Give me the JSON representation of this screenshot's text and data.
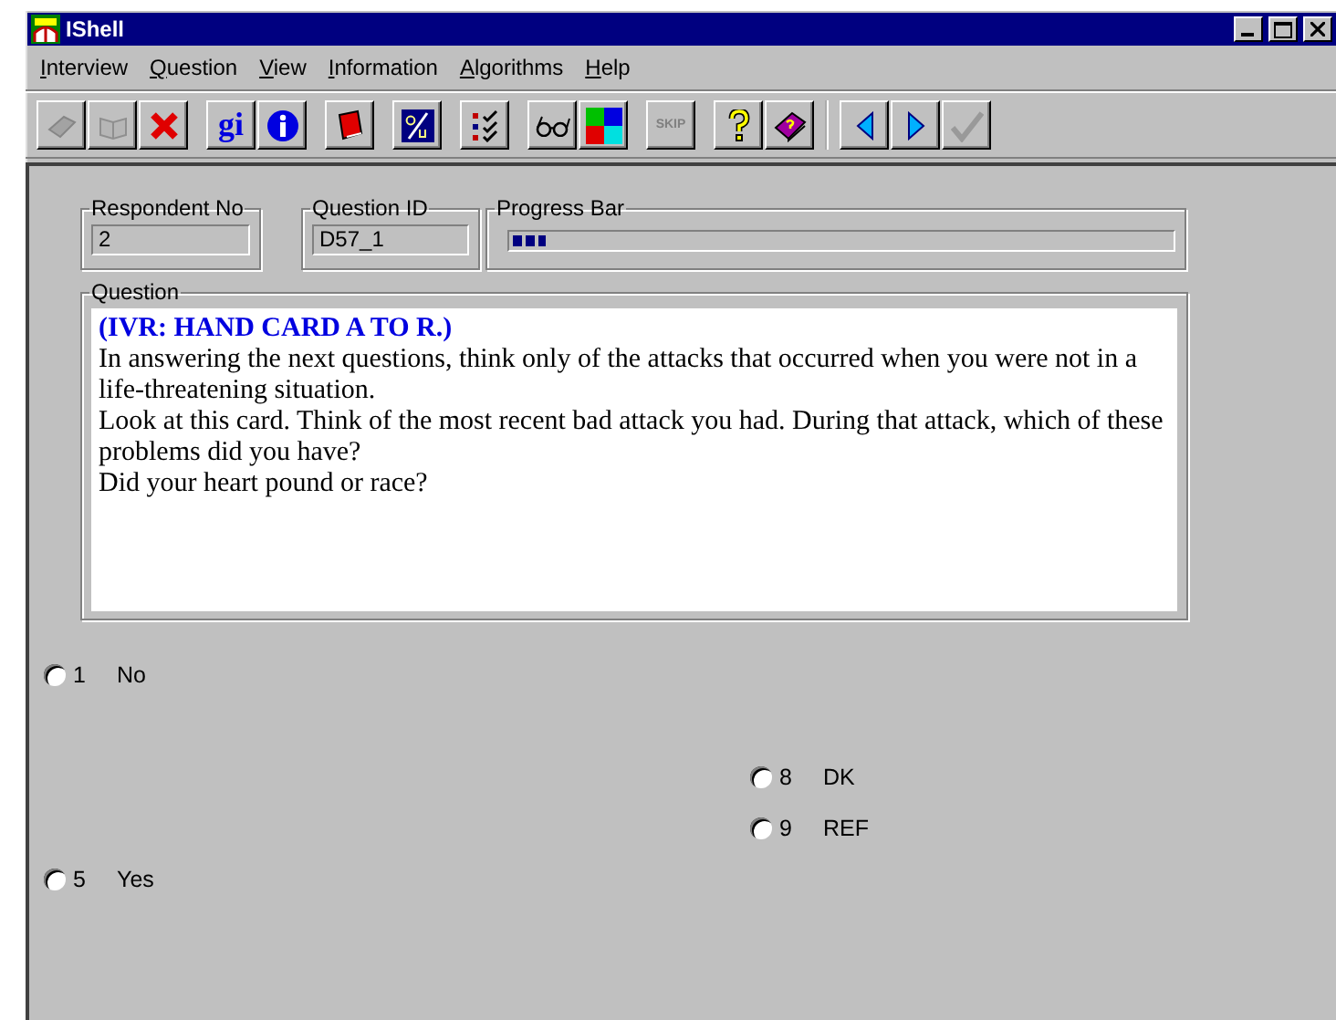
{
  "window": {
    "title": "IShell"
  },
  "menu": [
    {
      "key": "I",
      "rest": "nterview"
    },
    {
      "key": "Q",
      "rest": "uestion"
    },
    {
      "key": "V",
      "rest": "iew"
    },
    {
      "key": "I",
      "rest": "nformation"
    },
    {
      "key": "A",
      "rest": "lgorithms"
    },
    {
      "key": "H",
      "rest": "elp"
    }
  ],
  "toolbar": [
    [
      {
        "kind": "book",
        "disabled": true
      },
      {
        "kind": "open-book",
        "disabled": true
      },
      {
        "kind": "delete",
        "disabled": false
      }
    ],
    [
      {
        "kind": "text",
        "label": "gi",
        "disabled": false
      },
      {
        "kind": "info",
        "disabled": false
      }
    ],
    [
      {
        "kind": "red-book",
        "disabled": false
      }
    ],
    [
      {
        "kind": "translate",
        "disabled": false
      }
    ],
    [
      {
        "kind": "checklist",
        "disabled": false
      }
    ],
    [
      {
        "kind": "glasses",
        "disabled": false
      },
      {
        "kind": "colors",
        "disabled": false
      }
    ],
    [
      {
        "kind": "skip",
        "label": "SKIP",
        "disabled": true
      }
    ],
    [
      {
        "kind": "help",
        "disabled": false
      },
      {
        "kind": "help-book",
        "disabled": false
      }
    ],
    [
      {
        "kind": "previous",
        "disabled": false
      },
      {
        "kind": "next",
        "disabled": false
      },
      {
        "kind": "confirm",
        "disabled": true
      }
    ]
  ],
  "respondent": {
    "label": "Respondent No",
    "value": "2"
  },
  "question_id": {
    "label": "Question ID",
    "value": "D57_1"
  },
  "progress": {
    "label": "Progress Bar",
    "level": 0.05
  },
  "question": {
    "label": "Question",
    "lines": [
      {
        "kind": "instruction",
        "text": "(IVR: HAND CARD A TO R.)"
      },
      {
        "kind": "text",
        "text": "In answering the next questions, think only of the attacks that occurred when you were not in a life-threatening situation."
      },
      {
        "kind": "text",
        "text": "Look at this card. Think of the most recent bad attack you had. During that attack, which of these problems did you have?"
      },
      {
        "kind": "text",
        "text": "Did your heart pound or race?"
      }
    ]
  },
  "answers": [
    {
      "code": "1",
      "label": "No",
      "selected": false
    },
    {
      "code": "8",
      "label": "DK",
      "selected": false
    },
    {
      "code": "9",
      "label": "REF",
      "selected": false
    },
    {
      "code": "5",
      "label": "Yes",
      "selected": false
    }
  ]
}
